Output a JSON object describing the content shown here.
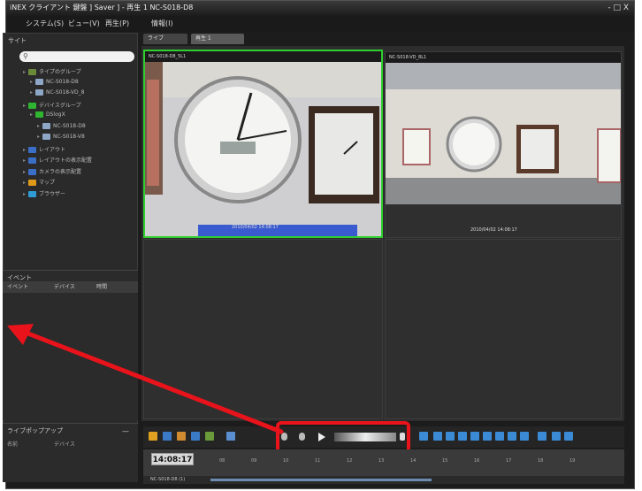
{
  "window": {
    "title": "iNEX クライアント 鍵盤 ] Saver ] - 再生 1  NC-S018-D8",
    "controls": "- □ X"
  },
  "menu": {
    "items": [
      "システム(S)",
      "ビュー(V)",
      "再生(P)",
      "情報(I)"
    ]
  },
  "sidebar": {
    "site_title": "サイト",
    "search_placeholder": "",
    "tree": [
      {
        "label": "タイプのグループ",
        "icon_color": "#6a8a3a"
      },
      {
        "label": "NC-S018-D8",
        "icon_color": "#8fa7c7"
      },
      {
        "label": "NC-S018-VD_8",
        "icon_color": "#8fa7c7"
      },
      {
        "label": "デバイスグループ",
        "icon_color": "#2fb52f"
      },
      {
        "label": "DSlogX",
        "icon_color": "#2fb52f"
      },
      {
        "label": "NC-S018-D8",
        "icon_color": "#8fa7c7"
      },
      {
        "label": "NC-S018-V8",
        "icon_color": "#8fa7c7"
      },
      {
        "label": "レイアウト",
        "icon_color": "#3b6fc7"
      },
      {
        "label": "レイアウトの表示配置",
        "icon_color": "#3b6fc7"
      },
      {
        "label": "カメラの表示配置",
        "icon_color": "#3b6fc7"
      },
      {
        "label": "マップ",
        "icon_color": "#e09a1a"
      },
      {
        "label": "ブラウザー",
        "icon_color": "#2e9ad6"
      }
    ],
    "event_title": "イベント",
    "event_columns": [
      "イベント",
      "デバイス",
      "時間"
    ],
    "live_title": "ライブポップアップ",
    "live_columns": [
      "名前",
      "デバイス"
    ]
  },
  "tabs": [
    "ライブ",
    "再生 1"
  ],
  "tiles": [
    {
      "title": "NC-S018-D8_5L1",
      "timestamp": "2010/04/02 14:08:17"
    },
    {
      "title": "NC-S018-VD_8L1",
      "timestamp": "2010/04/02 14:08:17"
    },
    {
      "title": "",
      "timestamp": ""
    },
    {
      "title": "",
      "timestamp": ""
    }
  ],
  "timeline": {
    "current_time": "14:08:17",
    "ticks": [
      "08",
      "09",
      "10",
      "11",
      "12",
      "13",
      "14",
      "15",
      "16",
      "17",
      "18",
      "19"
    ],
    "camera_label": "NC-S018-D8 (1)"
  },
  "playback": {
    "controls": [
      "rewind",
      "step-back",
      "play",
      "speed-slider",
      "step-forward"
    ]
  },
  "annotation": {
    "highlight_color": "#e8131b"
  },
  "colors": {
    "selected_tile_border": "#2fcf2f"
  }
}
